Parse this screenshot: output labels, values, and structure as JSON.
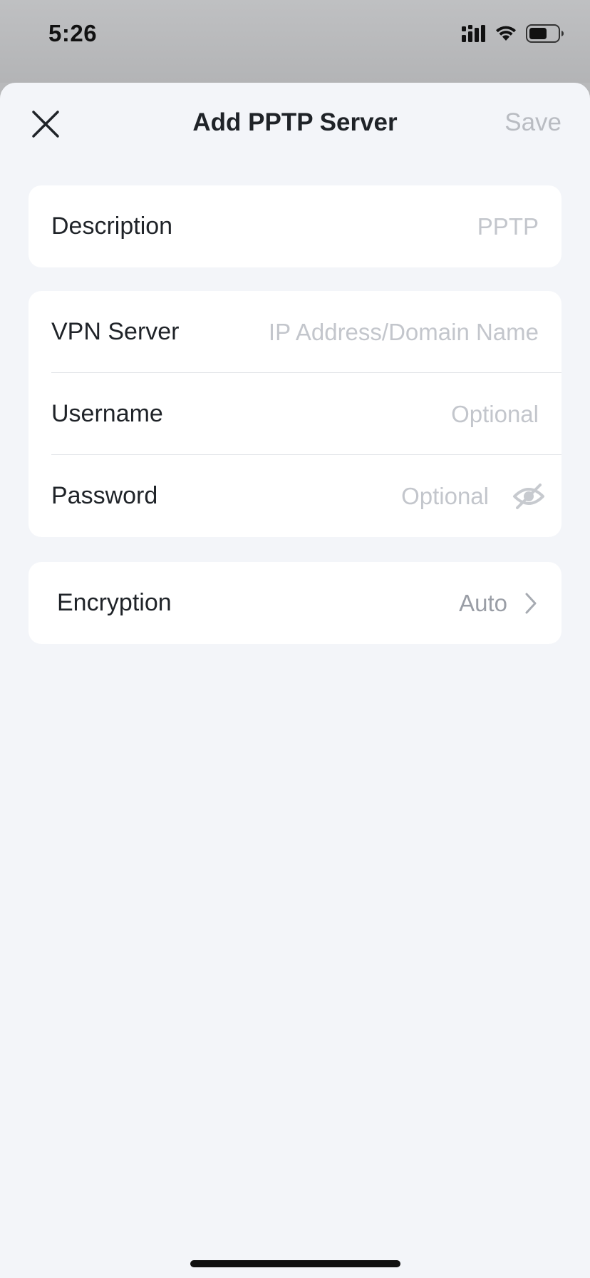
{
  "status_bar": {
    "time": "5:26",
    "icons": [
      "cellular-signal-icon",
      "wifi-icon",
      "battery-icon"
    ]
  },
  "header": {
    "title": "Add PPTP Server",
    "save_label": "Save",
    "close_icon": "close-icon"
  },
  "description_section": {
    "label": "Description",
    "placeholder": "PPTP"
  },
  "server_section": {
    "vpn_server": {
      "label": "VPN Server",
      "placeholder": "IP Address/Domain Name"
    },
    "username": {
      "label": "Username",
      "placeholder": "Optional"
    },
    "password": {
      "label": "Password",
      "placeholder": "Optional",
      "icon": "eye-hidden-icon"
    }
  },
  "encryption_section": {
    "label": "Encryption",
    "value": "Auto",
    "icon": "chevron-right-icon"
  },
  "colors": {
    "background": "#f3f5f9",
    "card": "#ffffff",
    "text": "#1f2328",
    "placeholder": "#c3c6cc",
    "disabled_action": "#b9bcc2"
  }
}
